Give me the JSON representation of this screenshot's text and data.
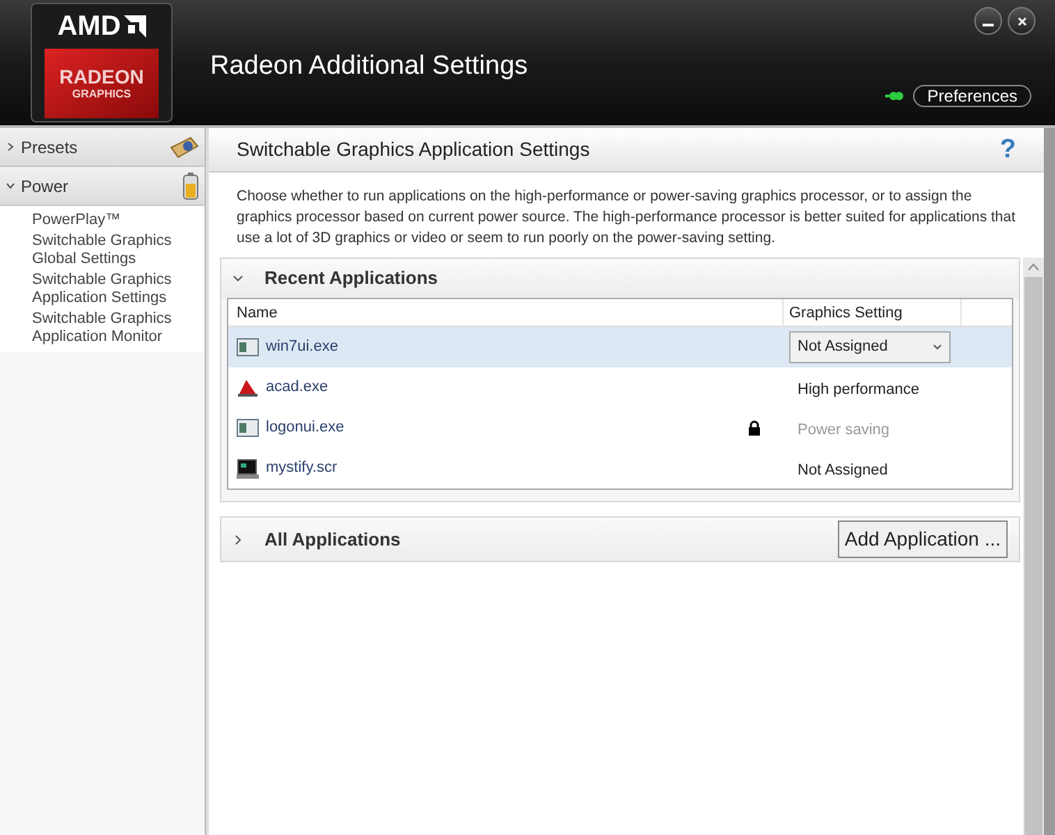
{
  "header": {
    "logo": {
      "brand": "AMD",
      "product": "RADEON",
      "subtitle": "GRAPHICS"
    },
    "title": "Radeon Additional Settings",
    "preferences_button": "Preferences"
  },
  "sidebar": {
    "sections": [
      {
        "label": "Presets",
        "expanded": false
      },
      {
        "label": "Power",
        "expanded": true,
        "children": [
          {
            "label": "PowerPlay™"
          },
          {
            "label": "Switchable Graphics Global Settings"
          },
          {
            "label": "Switchable Graphics Application Settings"
          },
          {
            "label": "Switchable Graphics Application Monitor"
          }
        ]
      }
    ]
  },
  "page": {
    "title": "Switchable Graphics Application Settings",
    "help": "?",
    "description": "Choose whether to run applications on the high-performance or power-saving graphics processor, or to assign the graphics processor based on current power source. The high-performance processor is better suited for applications that use a lot of 3D graphics or video or seem to run poorly on the power-saving setting.",
    "recent": {
      "title": "Recent Applications",
      "expanded": true,
      "columns": [
        "Name",
        "Graphics Setting"
      ],
      "rows": [
        {
          "kind": "window",
          "name": "win7ui.exe",
          "setting": "Not Assigned",
          "selected": true,
          "locked": false,
          "disabled": false
        },
        {
          "kind": "cad",
          "name": "acad.exe",
          "setting": "High performance",
          "selected": false,
          "locked": false,
          "disabled": false
        },
        {
          "kind": "window",
          "name": "logonui.exe",
          "setting": "Power saving",
          "selected": false,
          "locked": true,
          "disabled": true
        },
        {
          "kind": "monitor",
          "name": "mystify.scr",
          "setting": "Not Assigned",
          "selected": false,
          "locked": false,
          "disabled": false
        }
      ]
    },
    "all": {
      "title": "All Applications",
      "expanded": false,
      "add_button": "Add Application ..."
    }
  }
}
